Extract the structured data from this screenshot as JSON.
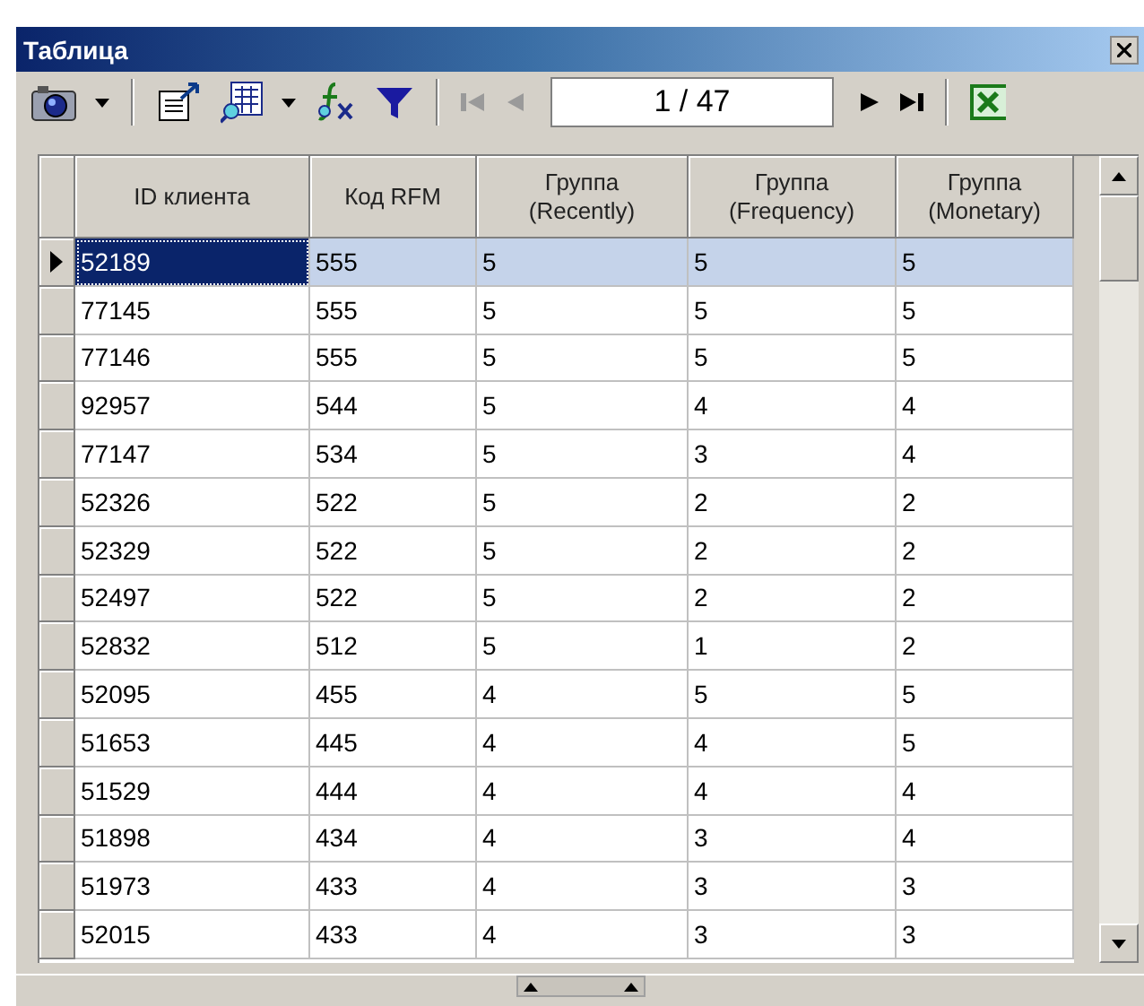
{
  "window": {
    "title": "Таблица"
  },
  "toolbar": {
    "page": "1 / 47",
    "first_disabled": true,
    "prev_disabled": true
  },
  "table": {
    "columns": [
      "ID клиента",
      "Код RFM",
      "Группа\n(Recently)",
      "Группа\n(Frequency)",
      "Группа\n(Monetary)"
    ],
    "rows": [
      {
        "selected": true,
        "cells": [
          "52189",
          "555",
          "5",
          "5",
          "5"
        ]
      },
      {
        "selected": false,
        "cells": [
          "77145",
          "555",
          "5",
          "5",
          "5"
        ]
      },
      {
        "selected": false,
        "cells": [
          "77146",
          "555",
          "5",
          "5",
          "5"
        ]
      },
      {
        "selected": false,
        "cells": [
          "92957",
          "544",
          "5",
          "4",
          "4"
        ]
      },
      {
        "selected": false,
        "cells": [
          "77147",
          "534",
          "5",
          "3",
          "4"
        ]
      },
      {
        "selected": false,
        "cells": [
          "52326",
          "522",
          "5",
          "2",
          "2"
        ]
      },
      {
        "selected": false,
        "cells": [
          "52329",
          "522",
          "5",
          "2",
          "2"
        ]
      },
      {
        "selected": false,
        "cells": [
          "52497",
          "522",
          "5",
          "2",
          "2"
        ]
      },
      {
        "selected": false,
        "cells": [
          "52832",
          "512",
          "5",
          "1",
          "2"
        ]
      },
      {
        "selected": false,
        "cells": [
          "52095",
          "455",
          "4",
          "5",
          "5"
        ]
      },
      {
        "selected": false,
        "cells": [
          "51653",
          "445",
          "4",
          "4",
          "5"
        ]
      },
      {
        "selected": false,
        "cells": [
          "51529",
          "444",
          "4",
          "4",
          "4"
        ]
      },
      {
        "selected": false,
        "cells": [
          "51898",
          "434",
          "4",
          "3",
          "4"
        ]
      },
      {
        "selected": false,
        "cells": [
          "51973",
          "433",
          "4",
          "3",
          "3"
        ]
      },
      {
        "selected": false,
        "cells": [
          "52015",
          "433",
          "4",
          "3",
          "3"
        ]
      }
    ]
  }
}
